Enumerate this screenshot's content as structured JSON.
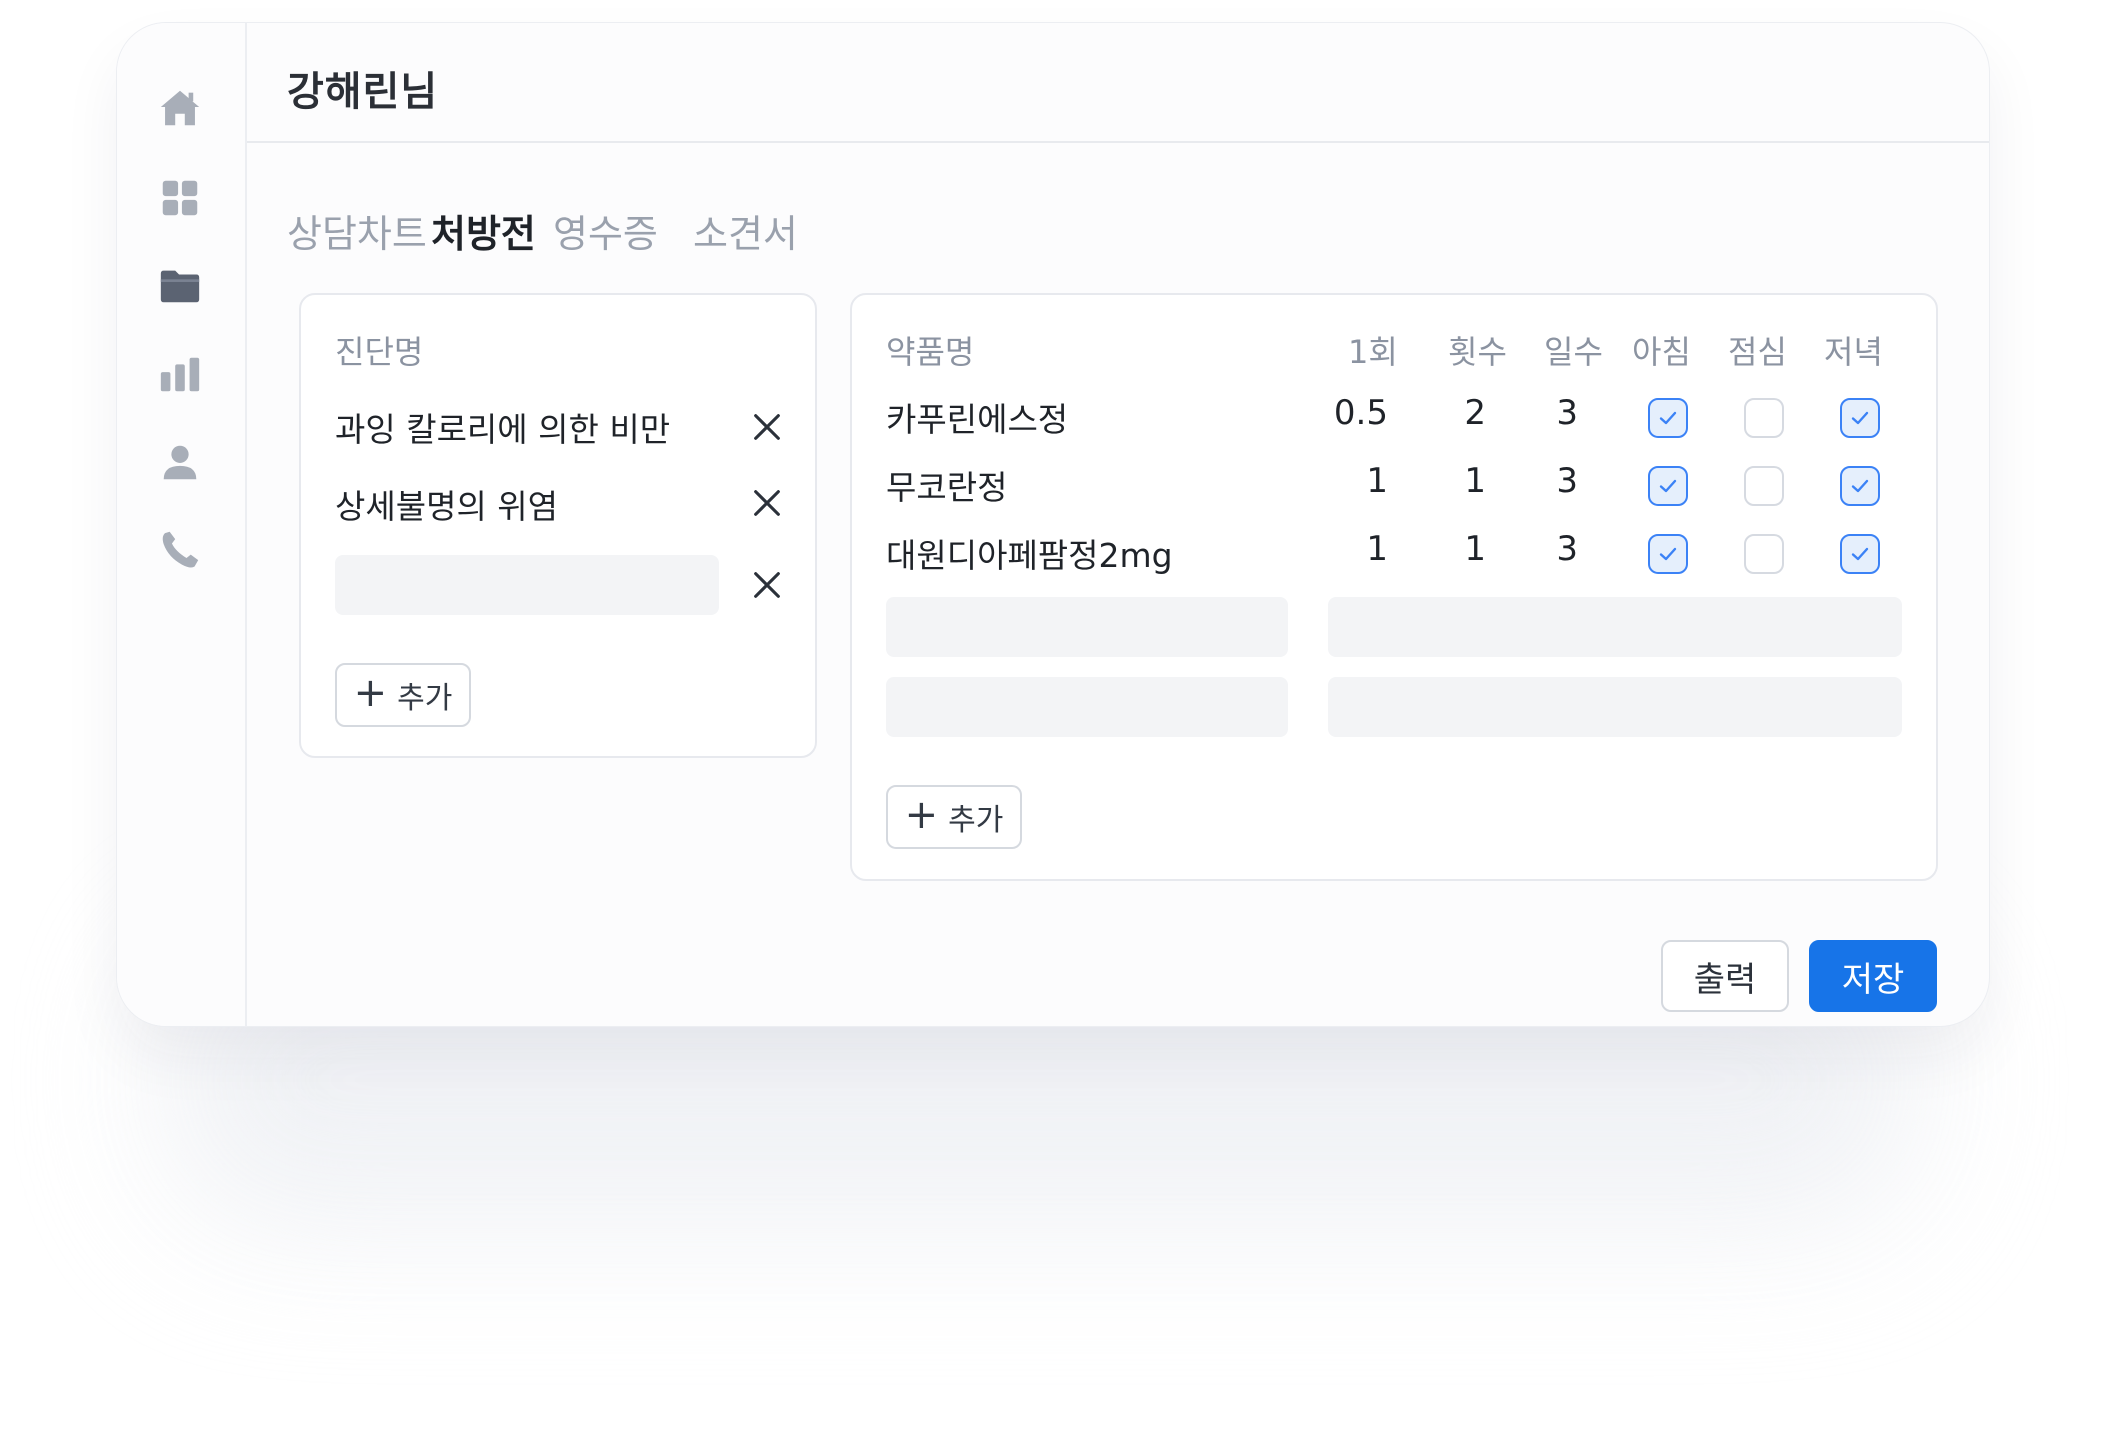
{
  "header": {
    "title": "강해린님"
  },
  "sidebar": {
    "icons": [
      "home-icon",
      "dashboard-icon",
      "folder-icon",
      "chart-icon",
      "user-icon",
      "phone-icon"
    ],
    "active": "folder-icon"
  },
  "tabs": [
    {
      "label": "상담차트",
      "active": false
    },
    {
      "label": "처방전",
      "active": true
    },
    {
      "label": "영수증",
      "active": false
    },
    {
      "label": "소견서",
      "active": false
    }
  ],
  "diagnosis": {
    "header": "진단명",
    "items": [
      "과잉 칼로리에 의한 비만",
      "상세불명의 위염"
    ],
    "empty_input_value": "",
    "add_label": "추가"
  },
  "medications": {
    "headers": {
      "name": "약품명",
      "dose": "1회",
      "times": "횟수",
      "days": "일수",
      "morning": "아침",
      "lunch": "점심",
      "evening": "저녁"
    },
    "rows": [
      {
        "name": "카푸린에스정",
        "dose": "0.5",
        "times": "2",
        "days": "3",
        "morning": true,
        "lunch": false,
        "evening": true
      },
      {
        "name": "무코란정",
        "dose": "1",
        "times": "1",
        "days": "3",
        "morning": true,
        "lunch": false,
        "evening": true
      },
      {
        "name": "대원디아페팜정2mg",
        "dose": "1",
        "times": "1",
        "days": "3",
        "morning": true,
        "lunch": false,
        "evening": true
      }
    ],
    "add_label": "추가"
  },
  "actions": {
    "print_label": "출력",
    "save_label": "저장"
  },
  "colors": {
    "accent": "#1774e8",
    "checkbox_on": "#3b82f6",
    "icon_gray": "#9aa1ad",
    "icon_active": "#5b6372"
  }
}
